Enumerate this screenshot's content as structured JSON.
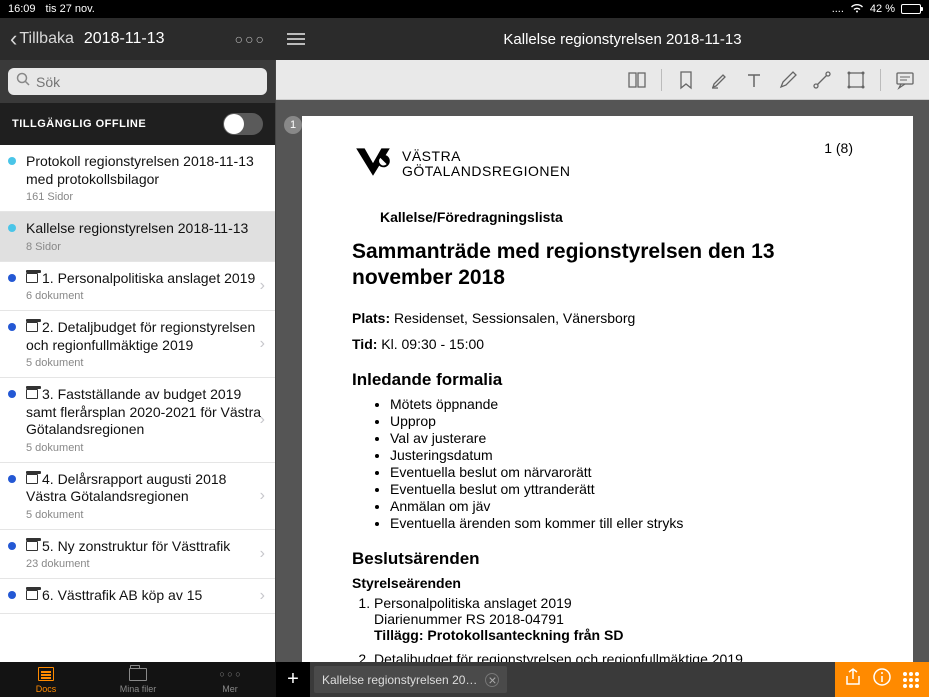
{
  "status": {
    "time": "16:09",
    "date": "tis 27 nov.",
    "battery": "42 %"
  },
  "header": {
    "back": "Tillbaka",
    "date": "2018-11-13",
    "title": "Kallelse regionstyrelsen 2018-11-13"
  },
  "search": {
    "placeholder": "Sök"
  },
  "offline": {
    "label": "TILLGÄNGLIG OFFLINE"
  },
  "sidebar": [
    {
      "title": "Protokoll  regionstyrelsen 2018-11-13 med protokollsbilagor",
      "sub": "161 Sidor",
      "dot": "cyan",
      "arch": false,
      "chev": false,
      "active": false
    },
    {
      "title": "Kallelse regionstyrelsen 2018-11-13",
      "sub": "8 Sidor",
      "dot": "cyan",
      "arch": false,
      "chev": false,
      "active": true
    },
    {
      "title": "1. Personalpolitiska anslaget 2019",
      "sub": "6 dokument",
      "dot": "blue",
      "arch": true,
      "chev": true,
      "active": false
    },
    {
      "title": "2. Detaljbudget för regionstyrelsen och regionfullmäktige 2019",
      "sub": "5 dokument",
      "dot": "blue",
      "arch": true,
      "chev": true,
      "active": false
    },
    {
      "title": "3. Fastställande av budget 2019 samt flerårsplan 2020-2021 för Västra Götalandsregionen",
      "sub": "5 dokument",
      "dot": "blue",
      "arch": true,
      "chev": true,
      "active": false
    },
    {
      "title": "4. Delårsrapport augusti 2018 Västra Götalandsregionen",
      "sub": "5 dokument",
      "dot": "blue",
      "arch": true,
      "chev": true,
      "active": false
    },
    {
      "title": "5. Ny zonstruktur för Västtrafik",
      "sub": "23 dokument",
      "dot": "blue",
      "arch": true,
      "chev": true,
      "active": false
    },
    {
      "title": "6. Västtrafik AB köp av 15",
      "sub": "",
      "dot": "blue",
      "arch": true,
      "chev": true,
      "active": false
    }
  ],
  "page": {
    "badge": "1",
    "logo1": "VÄSTRA",
    "logo2": "GÖTALANDSREGIONEN",
    "pagenum": "1 (8)",
    "subtitle": "Kallelse/Föredragningslista",
    "h1": "Sammanträde med regionstyrelsen den 13 november 2018",
    "plats_label": "Plats:",
    "plats": " Residenset, Sessionsalen, Vänersborg",
    "tid_label": "Tid:",
    "tid": " Kl. 09:30 - 15:00",
    "h2a": "Inledande formalia",
    "formalia": [
      "Mötets öppnande",
      "Upprop",
      "Val av justerare",
      "Justeringsdatum",
      "Eventuella beslut om närvarorätt",
      "Eventuella beslut om yttranderätt",
      "Anmälan om jäv",
      "Eventuella ärenden som kommer till eller stryks"
    ],
    "h2b": "Beslutsärenden",
    "h3": "Styrelseärenden",
    "ol1_a": "Personalpolitiska anslaget 2019",
    "ol1_b": "Diarienummer RS 2018-04791",
    "ol1_c": "Tillägg: Protokollsanteckning från SD",
    "ol2_a": "Detaljbudget för regionstyrelsen och regionfullmäktige 2019"
  },
  "bottom": {
    "docs": "Docs",
    "files": "Mina filer",
    "more": "Mer",
    "tab": "Kallelse regionstyrelsen 20…"
  }
}
